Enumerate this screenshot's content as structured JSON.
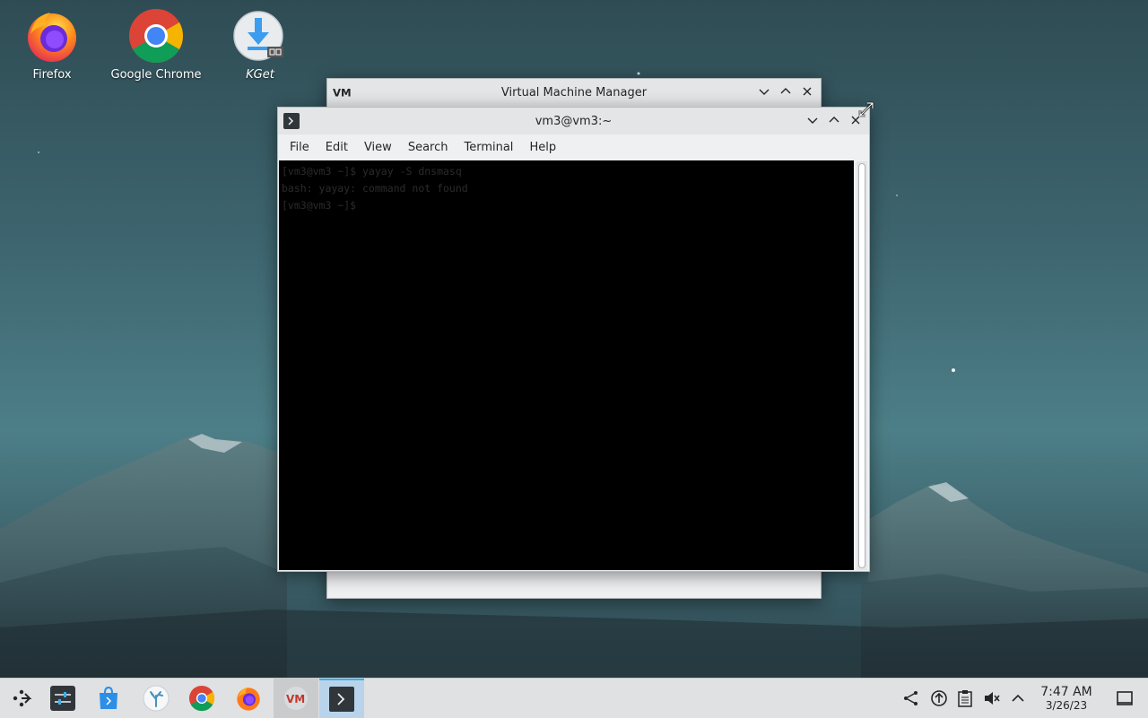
{
  "desktop": {
    "icons": [
      {
        "label": "Firefox",
        "icon": "firefox-icon"
      },
      {
        "label": "Google Chrome",
        "icon": "chrome-icon"
      },
      {
        "label": "KGet",
        "icon": "kget-icon"
      }
    ]
  },
  "vmm_window": {
    "title": "Virtual Machine Manager",
    "icon": "vmm-icon"
  },
  "terminal_window": {
    "title": "vm3@vm3:~",
    "menu": [
      "File",
      "Edit",
      "View",
      "Search",
      "Terminal",
      "Help"
    ],
    "lines": [
      "[vm3@vm3 ~]$ yayay -S dnsmasq",
      "bash: yayay: command not found",
      "[vm3@vm3 ~]$ "
    ]
  },
  "taskbar": {
    "launcher_icon": "application-launcher-icon",
    "apps": [
      {
        "name": "system-settings",
        "icon": "settings-icon"
      },
      {
        "name": "discover",
        "icon": "store-icon"
      },
      {
        "name": "corals",
        "icon": "coral-icon"
      },
      {
        "name": "google-chrome",
        "icon": "chrome-icon"
      },
      {
        "name": "firefox",
        "icon": "firefox-icon"
      },
      {
        "name": "virtual-machine-manager",
        "icon": "vmm-icon"
      },
      {
        "name": "konsole",
        "icon": "terminal-icon"
      }
    ],
    "tray": [
      "network-icon",
      "updates-icon",
      "clipboard-icon",
      "volume-muted-icon",
      "expand-tray-icon"
    ],
    "clock": {
      "time": "7:47 AM",
      "date": "3/26/23"
    },
    "show_desktop_icon": "show-desktop-icon"
  },
  "colors": {
    "accent": "#3daee9",
    "titlebar": "#e3e5e7",
    "window_bg": "#eff0f1",
    "terminal_bg": "#000000"
  }
}
